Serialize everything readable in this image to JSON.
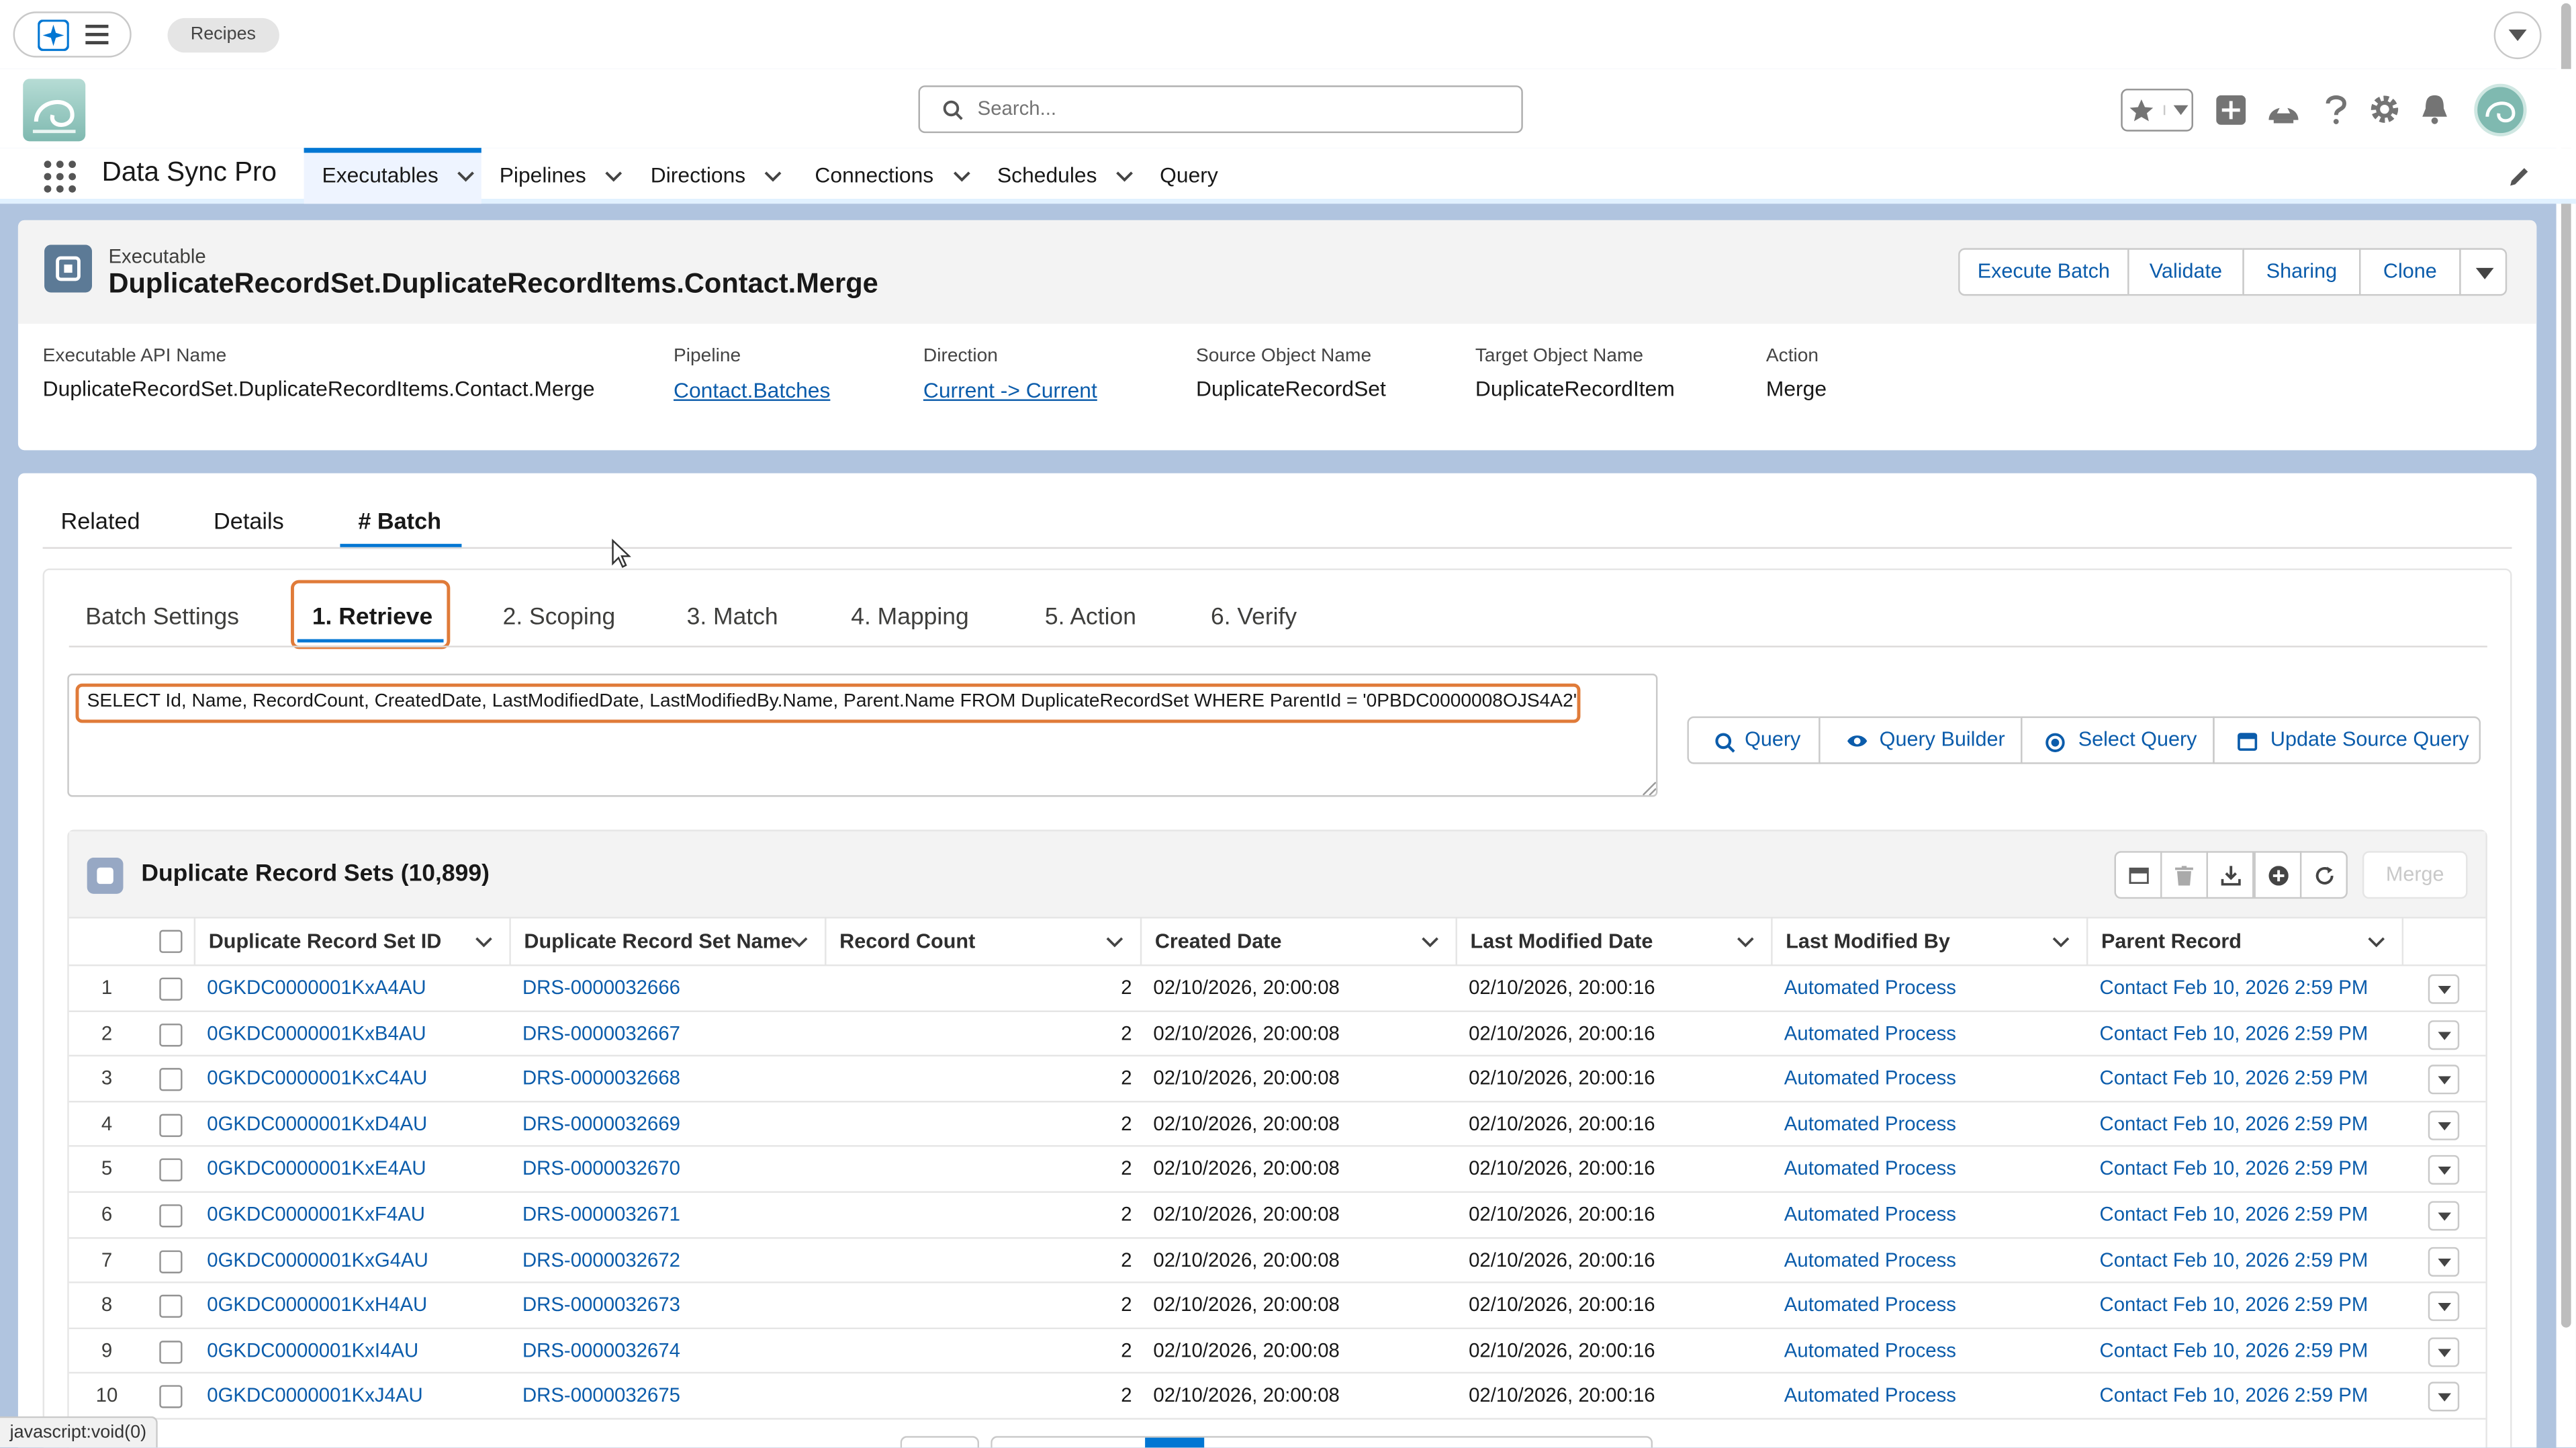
{
  "browser_tabs": {
    "recipes": "Recipes"
  },
  "status_bar": "javascript:void(0)",
  "header": {
    "search_placeholder": "Search...",
    "app_name": "Data Sync Pro"
  },
  "nav": {
    "items": [
      {
        "label": "Executables",
        "has_menu": true,
        "active": true
      },
      {
        "label": "Pipelines",
        "has_menu": true
      },
      {
        "label": "Directions",
        "has_menu": true
      },
      {
        "label": "Connections",
        "has_menu": true
      },
      {
        "label": "Schedules",
        "has_menu": true
      },
      {
        "label": "Query",
        "has_menu": false
      }
    ]
  },
  "record": {
    "object_label": "Executable",
    "title": "DuplicateRecordSet.DuplicateRecordItems.Contact.Merge",
    "actions": [
      "Execute Batch",
      "Validate",
      "Sharing",
      "Clone"
    ],
    "fields": [
      {
        "label": "Executable API Name",
        "value": "DuplicateRecordSet.DuplicateRecordItems.Contact.Merge",
        "link": false
      },
      {
        "label": "Pipeline",
        "value": "Contact.Batches",
        "link": true
      },
      {
        "label": "Direction",
        "value": "Current -> Current",
        "link": true
      },
      {
        "label": "Source Object Name",
        "value": "DuplicateRecordSet",
        "link": false
      },
      {
        "label": "Target Object Name",
        "value": "DuplicateRecordItem",
        "link": false
      },
      {
        "label": "Action",
        "value": "Merge",
        "link": false
      }
    ]
  },
  "tabs": {
    "items": [
      "Related",
      "Details",
      "# Batch"
    ],
    "active": "# Batch"
  },
  "subtabs": {
    "items": [
      "Batch Settings",
      "1. Retrieve",
      "2. Scoping",
      "3. Match",
      "4. Mapping",
      "5. Action",
      "6. Verify"
    ],
    "active": "1. Retrieve"
  },
  "query": {
    "text": "SELECT Id, Name, RecordCount, CreatedDate, LastModifiedDate, LastModifiedBy.Name, Parent.Name FROM DuplicateRecordSet WHERE ParentId = '0PBDC0000008OJS4A2'",
    "buttons": [
      {
        "label": "Query",
        "icon": "search-icon"
      },
      {
        "label": "Query Builder",
        "icon": "eye-icon"
      },
      {
        "label": "Select Query",
        "icon": "target-icon"
      },
      {
        "label": "Update Source Query",
        "icon": "calendar-icon"
      }
    ]
  },
  "list": {
    "title": "Duplicate Record Sets (10,899)",
    "merge_label": "Merge",
    "columns": [
      "Duplicate Record Set ID",
      "Duplicate Record Set Name",
      "Record Count",
      "Created Date",
      "Last Modified Date",
      "Last Modified By",
      "Parent Record"
    ],
    "rows": [
      {
        "n": "1",
        "id": "0GKDC0000001KxA4AU",
        "name": "DRS-0000032666",
        "count": "2",
        "created": "02/10/2026, 20:00:08",
        "modified": "02/10/2026, 20:00:16",
        "by": "Automated Process",
        "parent": "Contact Feb 10, 2026 2:59 PM"
      },
      {
        "n": "2",
        "id": "0GKDC0000001KxB4AU",
        "name": "DRS-0000032667",
        "count": "2",
        "created": "02/10/2026, 20:00:08",
        "modified": "02/10/2026, 20:00:16",
        "by": "Automated Process",
        "parent": "Contact Feb 10, 2026 2:59 PM"
      },
      {
        "n": "3",
        "id": "0GKDC0000001KxC4AU",
        "name": "DRS-0000032668",
        "count": "2",
        "created": "02/10/2026, 20:00:08",
        "modified": "02/10/2026, 20:00:16",
        "by": "Automated Process",
        "parent": "Contact Feb 10, 2026 2:59 PM"
      },
      {
        "n": "4",
        "id": "0GKDC0000001KxD4AU",
        "name": "DRS-0000032669",
        "count": "2",
        "created": "02/10/2026, 20:00:08",
        "modified": "02/10/2026, 20:00:16",
        "by": "Automated Process",
        "parent": "Contact Feb 10, 2026 2:59 PM"
      },
      {
        "n": "5",
        "id": "0GKDC0000001KxE4AU",
        "name": "DRS-0000032670",
        "count": "2",
        "created": "02/10/2026, 20:00:08",
        "modified": "02/10/2026, 20:00:16",
        "by": "Automated Process",
        "parent": "Contact Feb 10, 2026 2:59 PM"
      },
      {
        "n": "6",
        "id": "0GKDC0000001KxF4AU",
        "name": "DRS-0000032671",
        "count": "2",
        "created": "02/10/2026, 20:00:08",
        "modified": "02/10/2026, 20:00:16",
        "by": "Automated Process",
        "parent": "Contact Feb 10, 2026 2:59 PM"
      },
      {
        "n": "7",
        "id": "0GKDC0000001KxG4AU",
        "name": "DRS-0000032672",
        "count": "2",
        "created": "02/10/2026, 20:00:08",
        "modified": "02/10/2026, 20:00:16",
        "by": "Automated Process",
        "parent": "Contact Feb 10, 2026 2:59 PM"
      },
      {
        "n": "8",
        "id": "0GKDC0000001KxH4AU",
        "name": "DRS-0000032673",
        "count": "2",
        "created": "02/10/2026, 20:00:08",
        "modified": "02/10/2026, 20:00:16",
        "by": "Automated Process",
        "parent": "Contact Feb 10, 2026 2:59 PM"
      },
      {
        "n": "9",
        "id": "0GKDC0000001KxI4AU",
        "name": "DRS-0000032674",
        "count": "2",
        "created": "02/10/2026, 20:00:08",
        "modified": "02/10/2026, 20:00:16",
        "by": "Automated Process",
        "parent": "Contact Feb 10, 2026 2:59 PM"
      },
      {
        "n": "10",
        "id": "0GKDC0000001KxJ4AU",
        "name": "DRS-0000032675",
        "count": "2",
        "created": "02/10/2026, 20:00:08",
        "modified": "02/10/2026, 20:00:16",
        "by": "Automated Process",
        "parent": "Contact Feb 10, 2026 2:59 PM"
      }
    ]
  },
  "colors": {
    "brand_blue": "#0176d3",
    "link_blue": "#0b5cab",
    "highlight_orange": "#e07b39",
    "page_background": "#b0c4df"
  }
}
